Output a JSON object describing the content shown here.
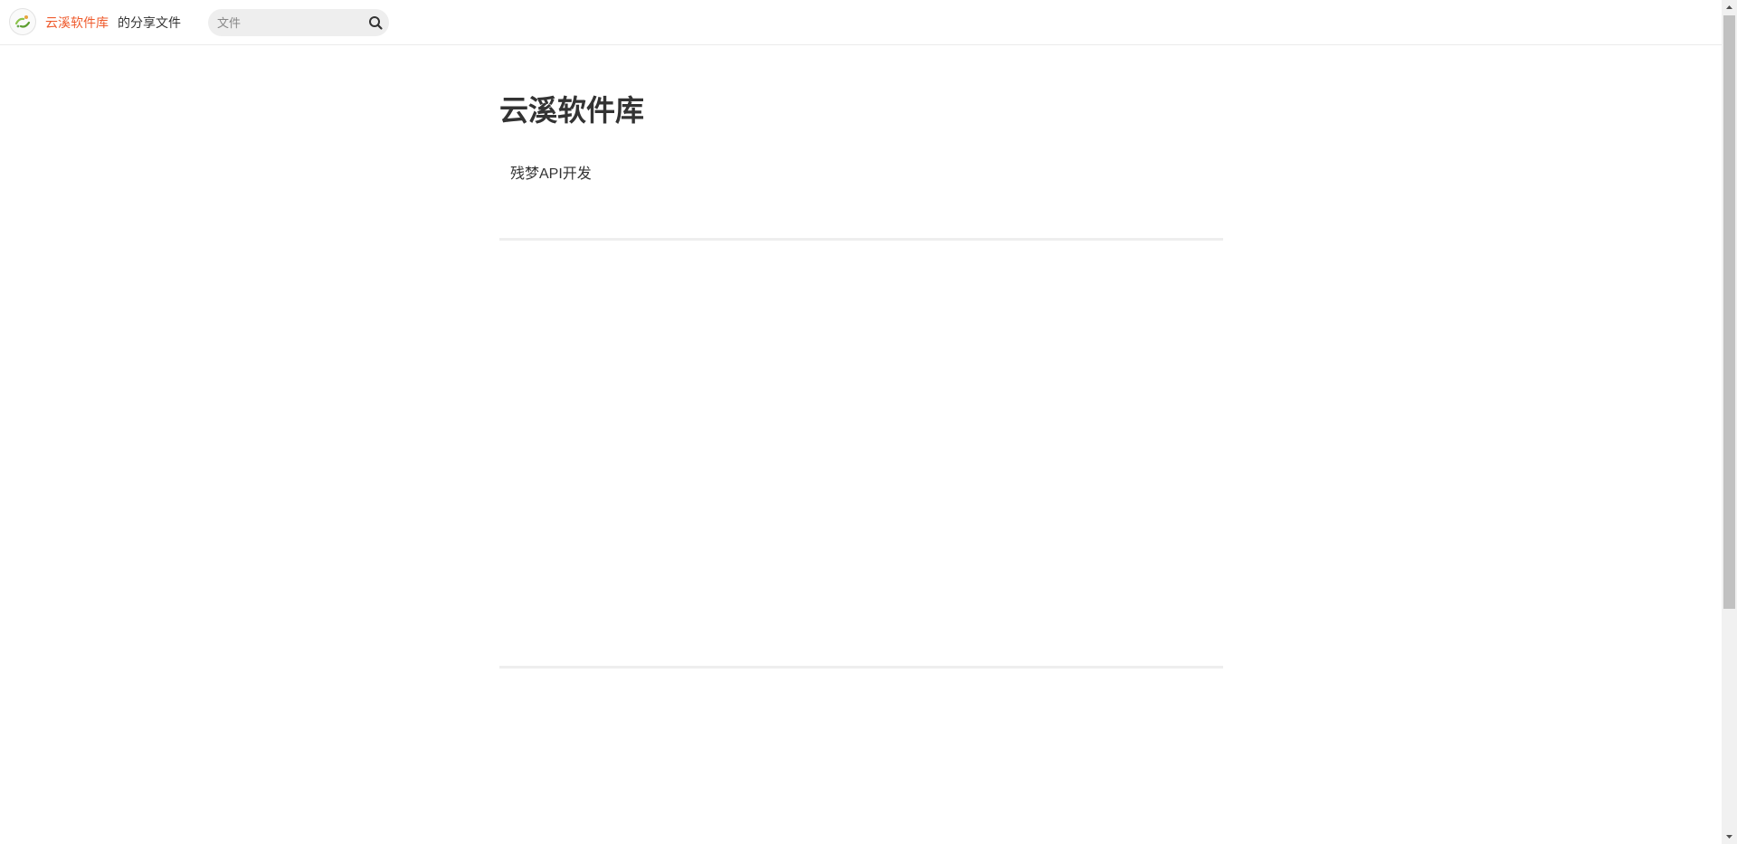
{
  "header": {
    "owner_name": "云溪软件库",
    "owner_suffix": "的分享文件",
    "search": {
      "placeholder": "文件",
      "value": ""
    },
    "icons": {
      "avatar": "avatar-logo",
      "search": "search-icon"
    }
  },
  "main": {
    "title": "云溪软件库",
    "description": "残梦API开发",
    "file_items": []
  },
  "colors": {
    "accent": "#ef5b2d",
    "text": "#333333",
    "divider": "#eeeeee",
    "search_bg": "#eeeeee"
  }
}
